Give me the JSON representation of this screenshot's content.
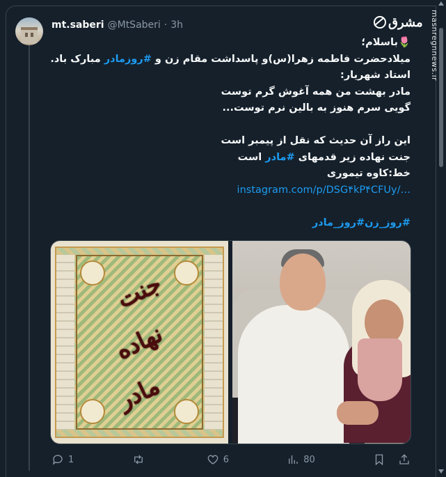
{
  "tweet": {
    "author_name": "mt.saberi",
    "author_handle": "@MtSaberi",
    "separator": "·",
    "time": "3h",
    "text_lines": [
      "🌷باسلام؛",
      "__MIXED1__",
      "استاد شهریار:",
      "مادر بهشت من همه آغوش گرم توست",
      "گویی سرم هنوز به بالین نرم توست...",
      "",
      "این راز آن حدیث که نقل از پیمبر است",
      "__MIXED2__",
      "خط:کاوه تیموری",
      "__LINK__",
      "",
      "__TAGS__"
    ],
    "line2": {
      "pre": "میلادحضرت فاطمه زهرا(س)و پاسداشت مقام زن و ",
      "hashtag": "#روزمادر",
      "post": " مبارک باد."
    },
    "line8": {
      "pre": "جنت نهاده زیر قدمهای ",
      "hashtag": "#مادر",
      "post": " است"
    },
    "link": "instagram.com/p/DSG۴kP۴CFUy/…",
    "hashtags": [
      "#روز_زن",
      "#روز_مادر"
    ]
  },
  "source_watermark": {
    "logo_text": "مشرق",
    "site_text": "mashreghnews.ir"
  },
  "actions": {
    "reply_count": "1",
    "retweet_count": "",
    "like_count": "6",
    "views_count": "80"
  },
  "icons": {
    "reply": "reply-icon",
    "retweet": "retweet-icon",
    "like": "heart-icon",
    "views": "views-icon",
    "bookmark": "bookmark-icon",
    "share": "share-icon"
  },
  "colors": {
    "background": "#15202b",
    "accent": "#1d9bf0",
    "muted": "#8b98a5",
    "border": "#38444d"
  }
}
